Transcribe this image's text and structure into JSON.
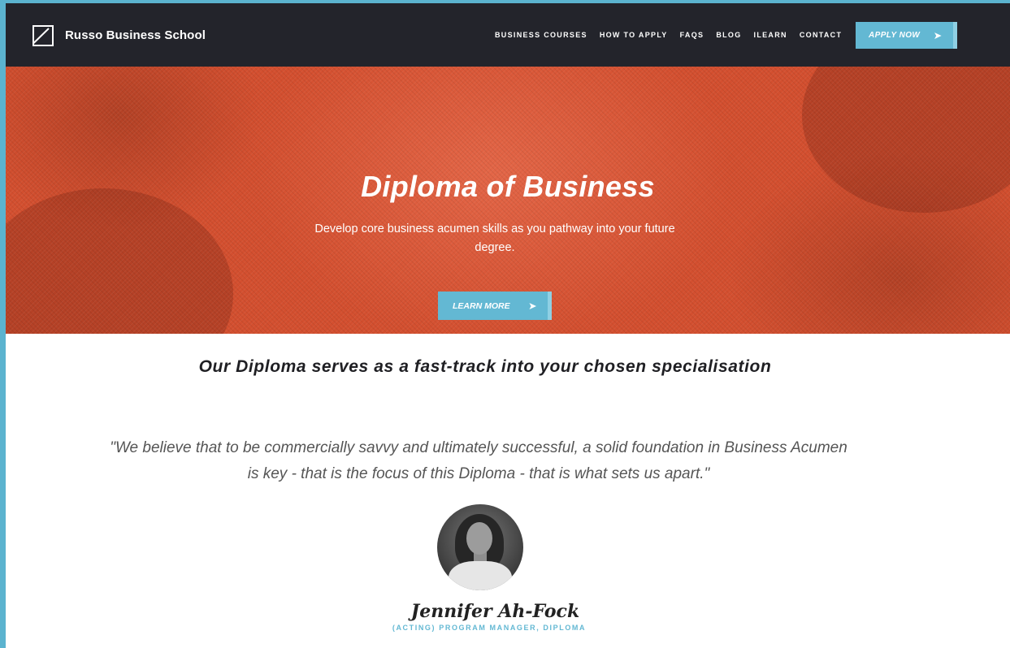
{
  "brand": {
    "logo_icon": "square-slash-icon",
    "name": "Russo Business School"
  },
  "nav": {
    "items": [
      {
        "label": "BUSINESS COURSES"
      },
      {
        "label": "HOW TO APPLY"
      },
      {
        "label": "FAQS"
      },
      {
        "label": "BLOG"
      },
      {
        "label": "ILEARN"
      },
      {
        "label": "CONTACT"
      }
    ],
    "cta_label": "APPLY NOW",
    "cta_icon": "arrow-right-icon"
  },
  "hero": {
    "title": "Diploma of Business",
    "subtitle": "Develop core business acumen skills as you pathway into your future degree.",
    "button_label": "LEARN MORE",
    "button_icon": "arrow-right-icon"
  },
  "content": {
    "tagline": "Our Diploma serves as a fast-track into your chosen specialisation",
    "quote": "\"We believe that to be commercially savvy and ultimately successful, a solid foundation in Business Acumen is key - that is the focus of this Diploma - that is what sets us apart.\"",
    "person_name": "Jennifer Ah-Fock",
    "person_role": "(ACTING) PROGRAM MANAGER, DIPLOMA"
  },
  "colors": {
    "nav_bg": "#23242b",
    "hero_overlay": "#d34f2f",
    "accent": "#63b8d3",
    "page_border": "#5bb3cf"
  }
}
